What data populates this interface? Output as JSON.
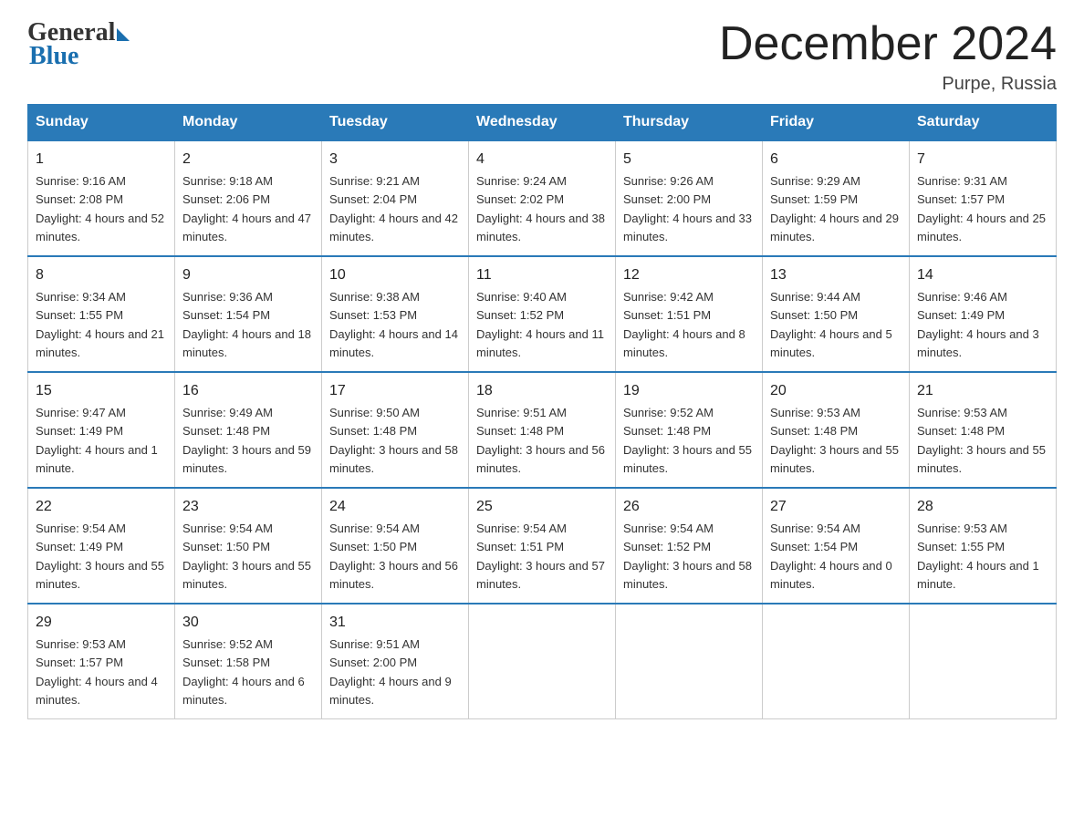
{
  "logo": {
    "general": "General",
    "blue": "Blue"
  },
  "header": {
    "title": "December 2024",
    "location": "Purpe, Russia"
  },
  "days_of_week": [
    "Sunday",
    "Monday",
    "Tuesday",
    "Wednesday",
    "Thursday",
    "Friday",
    "Saturday"
  ],
  "weeks": [
    [
      {
        "day": "1",
        "sunrise": "9:16 AM",
        "sunset": "2:08 PM",
        "daylight": "4 hours and 52 minutes."
      },
      {
        "day": "2",
        "sunrise": "9:18 AM",
        "sunset": "2:06 PM",
        "daylight": "4 hours and 47 minutes."
      },
      {
        "day": "3",
        "sunrise": "9:21 AM",
        "sunset": "2:04 PM",
        "daylight": "4 hours and 42 minutes."
      },
      {
        "day": "4",
        "sunrise": "9:24 AM",
        "sunset": "2:02 PM",
        "daylight": "4 hours and 38 minutes."
      },
      {
        "day": "5",
        "sunrise": "9:26 AM",
        "sunset": "2:00 PM",
        "daylight": "4 hours and 33 minutes."
      },
      {
        "day": "6",
        "sunrise": "9:29 AM",
        "sunset": "1:59 PM",
        "daylight": "4 hours and 29 minutes."
      },
      {
        "day": "7",
        "sunrise": "9:31 AM",
        "sunset": "1:57 PM",
        "daylight": "4 hours and 25 minutes."
      }
    ],
    [
      {
        "day": "8",
        "sunrise": "9:34 AM",
        "sunset": "1:55 PM",
        "daylight": "4 hours and 21 minutes."
      },
      {
        "day": "9",
        "sunrise": "9:36 AM",
        "sunset": "1:54 PM",
        "daylight": "4 hours and 18 minutes."
      },
      {
        "day": "10",
        "sunrise": "9:38 AM",
        "sunset": "1:53 PM",
        "daylight": "4 hours and 14 minutes."
      },
      {
        "day": "11",
        "sunrise": "9:40 AM",
        "sunset": "1:52 PM",
        "daylight": "4 hours and 11 minutes."
      },
      {
        "day": "12",
        "sunrise": "9:42 AM",
        "sunset": "1:51 PM",
        "daylight": "4 hours and 8 minutes."
      },
      {
        "day": "13",
        "sunrise": "9:44 AM",
        "sunset": "1:50 PM",
        "daylight": "4 hours and 5 minutes."
      },
      {
        "day": "14",
        "sunrise": "9:46 AM",
        "sunset": "1:49 PM",
        "daylight": "4 hours and 3 minutes."
      }
    ],
    [
      {
        "day": "15",
        "sunrise": "9:47 AM",
        "sunset": "1:49 PM",
        "daylight": "4 hours and 1 minute."
      },
      {
        "day": "16",
        "sunrise": "9:49 AM",
        "sunset": "1:48 PM",
        "daylight": "3 hours and 59 minutes."
      },
      {
        "day": "17",
        "sunrise": "9:50 AM",
        "sunset": "1:48 PM",
        "daylight": "3 hours and 58 minutes."
      },
      {
        "day": "18",
        "sunrise": "9:51 AM",
        "sunset": "1:48 PM",
        "daylight": "3 hours and 56 minutes."
      },
      {
        "day": "19",
        "sunrise": "9:52 AM",
        "sunset": "1:48 PM",
        "daylight": "3 hours and 55 minutes."
      },
      {
        "day": "20",
        "sunrise": "9:53 AM",
        "sunset": "1:48 PM",
        "daylight": "3 hours and 55 minutes."
      },
      {
        "day": "21",
        "sunrise": "9:53 AM",
        "sunset": "1:48 PM",
        "daylight": "3 hours and 55 minutes."
      }
    ],
    [
      {
        "day": "22",
        "sunrise": "9:54 AM",
        "sunset": "1:49 PM",
        "daylight": "3 hours and 55 minutes."
      },
      {
        "day": "23",
        "sunrise": "9:54 AM",
        "sunset": "1:50 PM",
        "daylight": "3 hours and 55 minutes."
      },
      {
        "day": "24",
        "sunrise": "9:54 AM",
        "sunset": "1:50 PM",
        "daylight": "3 hours and 56 minutes."
      },
      {
        "day": "25",
        "sunrise": "9:54 AM",
        "sunset": "1:51 PM",
        "daylight": "3 hours and 57 minutes."
      },
      {
        "day": "26",
        "sunrise": "9:54 AM",
        "sunset": "1:52 PM",
        "daylight": "3 hours and 58 minutes."
      },
      {
        "day": "27",
        "sunrise": "9:54 AM",
        "sunset": "1:54 PM",
        "daylight": "4 hours and 0 minutes."
      },
      {
        "day": "28",
        "sunrise": "9:53 AM",
        "sunset": "1:55 PM",
        "daylight": "4 hours and 1 minute."
      }
    ],
    [
      {
        "day": "29",
        "sunrise": "9:53 AM",
        "sunset": "1:57 PM",
        "daylight": "4 hours and 4 minutes."
      },
      {
        "day": "30",
        "sunrise": "9:52 AM",
        "sunset": "1:58 PM",
        "daylight": "4 hours and 6 minutes."
      },
      {
        "day": "31",
        "sunrise": "9:51 AM",
        "sunset": "2:00 PM",
        "daylight": "4 hours and 9 minutes."
      },
      null,
      null,
      null,
      null
    ]
  ]
}
